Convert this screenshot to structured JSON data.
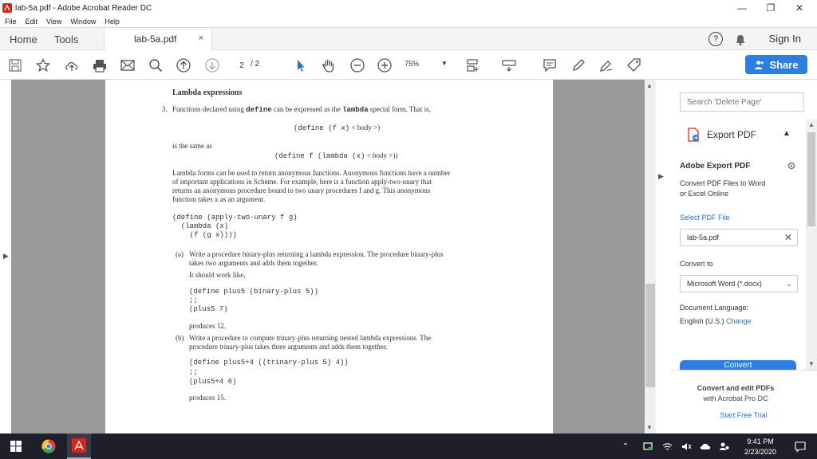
{
  "window": {
    "title": "lab-5a.pdf - Adobe Acrobat Reader DC",
    "minimize": "—",
    "restore": "❐",
    "close": "✕"
  },
  "menu": [
    "File",
    "Edit",
    "View",
    "Window",
    "Help"
  ],
  "tabs": {
    "home": "Home",
    "tools": "Tools",
    "document": "lab-5a.pdf",
    "close": "×",
    "help": "?",
    "sign_in": "Sign In"
  },
  "toolbar": {
    "page_current": "2",
    "page_total": "/ 2",
    "zoom": "75%",
    "share": "Share"
  },
  "page": {
    "heading": "Lambda expressions",
    "p3_num": "3.",
    "p3_text_a": "Functions declared using ",
    "p3_kw_define": "define",
    "p3_text_b": " can be expressed as the ",
    "p3_kw_lambda": "lambda",
    "p3_text_c": " special form. That is,",
    "code1_kw": "(define (f x)",
    "code1_rest": " < body >)",
    "same_as": "is the same as",
    "code2_kw": "(define f (lambda (x)",
    "code2_rest": " < body >))",
    "para1": [
      "Lambda forms can be used to return anonymous functions. Anonymous functions have a number",
      "of important applications in Scheme. For example, here is a function apply-two-unary that",
      "returns an anonymous procedure bound to two unary procedures f and g. This anonymous",
      "function takes x as an argument."
    ],
    "code3": [
      "(define (apply-two-unary f g)",
      "  (lambda (x)",
      "    (f (g x))))"
    ],
    "a_label": "(a)",
    "a_text": [
      "Write a procedure binary-plus returning a lambda expression. The procedure binary-plus",
      "takes two arguments and adds them together."
    ],
    "a_work": "It should work like,",
    "a_code": [
      "(define plus5 (binary-plus 5))",
      ";;",
      "(plus5 7)"
    ],
    "a_produces": "produces 12.",
    "b_label": "(b)",
    "b_text": [
      "Write a procedure to compute trinary-plus returning nested lambda expressions. The",
      "procedure trinary-plus takes three arguments and adds them together."
    ],
    "b_code": [
      "(define plus5+4 ((trinary-plus 5) 4))",
      ";;",
      "(plus5+4 6)"
    ],
    "b_produces": "produces 15."
  },
  "right_pane": {
    "search_placeholder": "Search 'Delete Page'",
    "export_title": "Export PDF",
    "adobe_export": "Adobe Export PDF",
    "convert_desc": [
      "Convert PDF Files to Word",
      "or Excel Online"
    ],
    "select_file": "Select PDF File",
    "file_name": "lab-5a.pdf",
    "convert_to": "Convert to",
    "format": "Microsoft Word (*.docx)",
    "doc_lang_label": "Document Language:",
    "doc_lang": "English (U.S.)",
    "change": "Change",
    "convert_button": "Convert",
    "promo": [
      "Convert and edit PDFs",
      "with Acrobat Pro DC"
    ],
    "trial": "Start Free Trial"
  },
  "taskbar": {
    "time": "9:41 PM",
    "date": "2/23/2020"
  },
  "colors": {
    "accent": "#2d7ee0",
    "taskbar": "#1f1f2b",
    "doc_bg": "#9a9a9a"
  }
}
